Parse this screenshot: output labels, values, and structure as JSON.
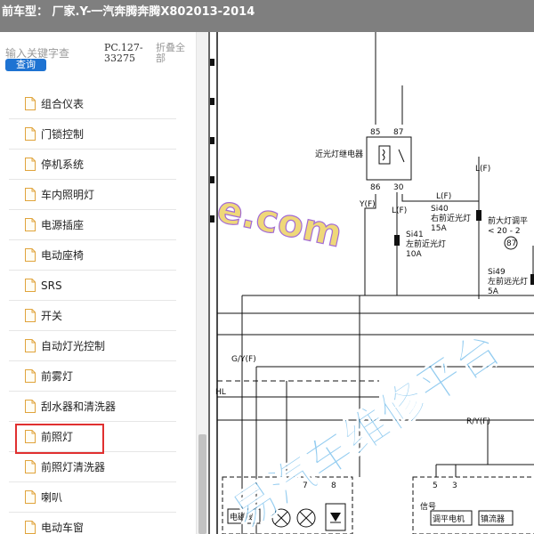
{
  "header": {
    "title": "前车型： 厂家.Y-一汽奔腾奔腾X802013-2014"
  },
  "search": {
    "placeholder": "输入关键字查",
    "button_label": "查询",
    "pc_code": "PC.127-33275",
    "collapse_label": "折叠全部"
  },
  "tree": {
    "items": [
      {
        "label": "组合仪表"
      },
      {
        "label": "门锁控制"
      },
      {
        "label": "停机系统"
      },
      {
        "label": "车内照明灯"
      },
      {
        "label": "电源插座"
      },
      {
        "label": "电动座椅"
      },
      {
        "label": "SRS"
      },
      {
        "label": "开关"
      },
      {
        "label": "自动灯光控制"
      },
      {
        "label": "前雾灯"
      },
      {
        "label": "刮水器和清洗器"
      },
      {
        "label": "前照灯"
      },
      {
        "label": "前照灯清洗器"
      },
      {
        "label": "喇叭"
      },
      {
        "label": "电动车窗"
      }
    ],
    "selected_index": 11
  },
  "diagram": {
    "relay_label": "近光灯继电器",
    "pins": {
      "p85": "85",
      "p87": "87",
      "p86": "86",
      "p30": "30",
      "p87b": "87"
    },
    "wires": {
      "yf": "Y(F)",
      "lf1": "L(F)",
      "lf2": "L(F)",
      "lf3": "L(F)",
      "gyf": "G/Y(F)",
      "hl": "HL",
      "ryf": "R/Y(F)"
    },
    "fuses": {
      "si41": "Si41",
      "si41_name": "左前近光灯",
      "si41_amp": "10A",
      "si40": "Si40",
      "si40_name": "右前近光灯",
      "si40_amp": "15A",
      "si49": "Si49",
      "si49_name": "左前远光灯",
      "si49_amp": "5A"
    },
    "dimmer": {
      "label": "前大灯调平",
      "range": "< 20 - 2"
    },
    "connectors": {
      "c7": "7",
      "c8": "8",
      "c5": "5",
      "c3": "3"
    },
    "components": {
      "valve": "电磁阀",
      "signal": "信号",
      "motor": "调平电机",
      "ballast": "镇流器"
    },
    "watermark": {
      "dot_text": "e.com",
      "main_text": "易汽车维修平台"
    }
  },
  "colors": {
    "topbar": "#7f7f7f",
    "button": "#1e73d2",
    "selected_border": "#e03030",
    "watermark": "#3aa3e3"
  }
}
